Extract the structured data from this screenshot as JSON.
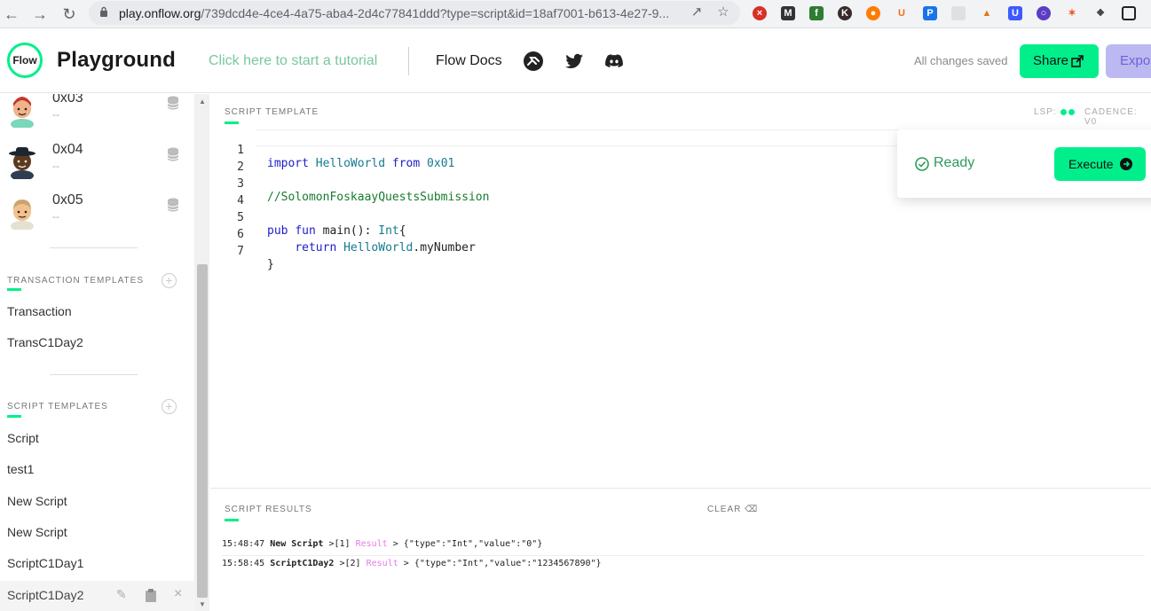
{
  "browser": {
    "url_host": "play.onflow.org",
    "url_rest": "/739dcd4e-4ce4-4a75-aba4-2d4c77841ddd?type=script&id=18af7001-b613-4e27-9..."
  },
  "header": {
    "logo_text": "Flow",
    "title": "Playground",
    "tutorial_link": "Click here to start a tutorial",
    "docs_link": "Flow Docs",
    "status": "All changes saved",
    "share_label": "Share",
    "export_label": "Expor",
    "accent_color": "#00ef8b"
  },
  "accounts": [
    {
      "address": "0x03",
      "sub": "--"
    },
    {
      "address": "0x04",
      "sub": "--"
    },
    {
      "address": "0x05",
      "sub": "--"
    }
  ],
  "transaction_templates": {
    "label": "TRANSACTION TEMPLATES",
    "items": [
      "Transaction",
      "TransC1Day2"
    ]
  },
  "script_templates": {
    "label": "SCRIPT TEMPLATES",
    "items": [
      "Script",
      "test1",
      "New Script",
      "New Script",
      "ScriptC1Day1",
      "ScriptC1Day2"
    ],
    "selected": "ScriptC1Day2"
  },
  "editor": {
    "label": "SCRIPT TEMPLATE",
    "lsp_label": "LSP:",
    "cadence_label": "CADENCE: V0",
    "line_numbers": [
      "1",
      "2",
      "3",
      "4",
      "5",
      "6",
      "7"
    ]
  },
  "ready_panel": {
    "status": "Ready",
    "execute_label": "Execute"
  },
  "results": {
    "label": "SCRIPT RESULTS",
    "clear_label": "CLEAR",
    "entries": [
      {
        "time": "15:48:47",
        "name": "New Script",
        "index": "[1]",
        "kind": "Result",
        "value": "{\"type\":\"Int\",\"value\":\"0\"}"
      },
      {
        "time": "15:58:45",
        "name": "ScriptC1Day2",
        "index": "[2]",
        "kind": "Result",
        "value": "{\"type\":\"Int\",\"value\":\"1234567890\"}"
      }
    ]
  }
}
